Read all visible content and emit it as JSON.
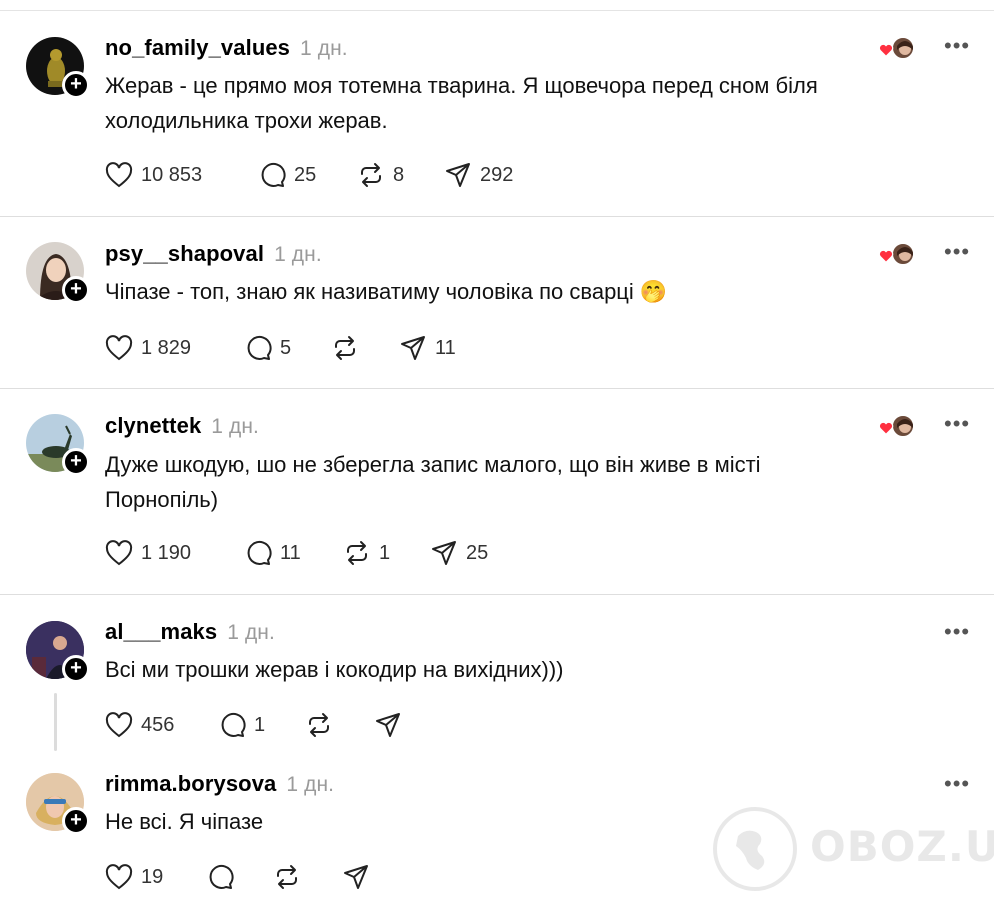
{
  "posts": [
    {
      "username": "no_family_values",
      "time": "1 дн.",
      "text": "Жерав - це прямо моя тотемна тварина. Я щовечора перед сном біля холодильника трохи жерав.",
      "likes": "10 853",
      "replies": "25",
      "reposts": "8",
      "shares": "292",
      "liked_by_author": true
    },
    {
      "username": "psy__shapoval",
      "time": "1 дн.",
      "text": "Чіпазе - топ, знаю як називатиму чоловіка по сварці 🤭",
      "likes": "1 829",
      "replies": "5",
      "reposts": "",
      "shares": "11",
      "liked_by_author": true
    },
    {
      "username": "clynettek",
      "time": "1 дн.",
      "text": "Дуже шкодую, шо не зберегла запис малого, що він живе в місті Порнопіль)",
      "likes": "1 190",
      "replies": "11",
      "reposts": "1",
      "shares": "25",
      "liked_by_author": true
    },
    {
      "username": "al___maks",
      "time": "1 дн.",
      "text": "Всі ми трошки жерав і кокодир на вихідних)))",
      "likes": "456",
      "replies": "1",
      "reposts": "",
      "shares": "",
      "liked_by_author": false
    },
    {
      "username": "rimma.borysova",
      "time": "1 дн.",
      "text": "Не всі. Я чіпазе",
      "likes": "19",
      "replies": "",
      "reposts": "",
      "shares": "",
      "liked_by_author": false
    }
  ],
  "watermark": "OBOZ.UA",
  "colors": {
    "heart": "#ff3040",
    "muted": "#9a9a9a",
    "separator": "#dedede"
  }
}
